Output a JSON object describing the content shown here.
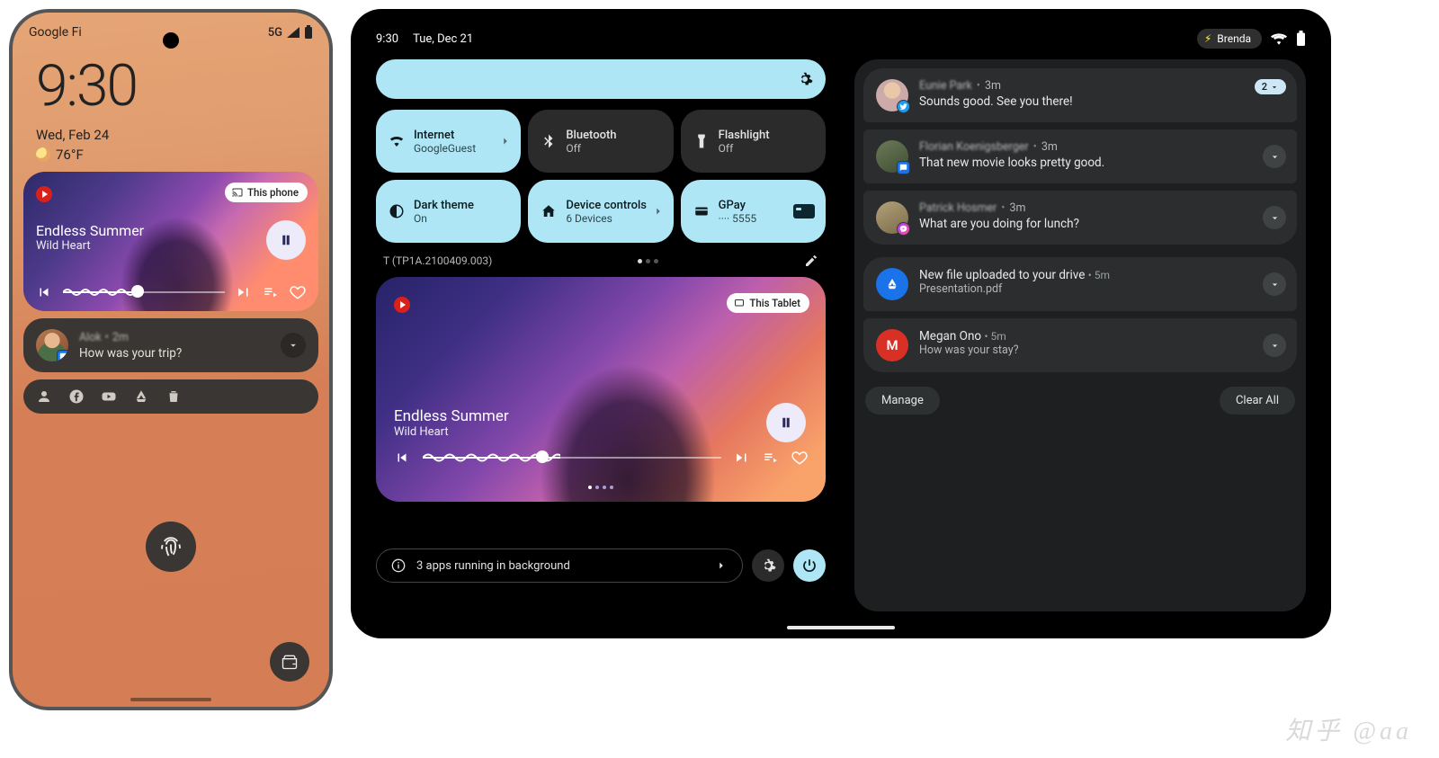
{
  "phone": {
    "status": {
      "carrier": "Google Fi",
      "net": "5G"
    },
    "clock": "9:30",
    "date": "Wed, Feb 24",
    "temp": "76°F",
    "media": {
      "chip": "This phone",
      "title": "Endless Summer",
      "artist": "Wild Heart"
    },
    "notif": {
      "name": "Alok",
      "time": "2m",
      "body": "How was your trip?"
    }
  },
  "tablet": {
    "status": {
      "time": "9:30",
      "date": "Tue, Dec 21",
      "user": "Brenda"
    },
    "tiles": {
      "internet": {
        "title": "Internet",
        "sub": "GoogleGuest"
      },
      "bluetooth": {
        "title": "Bluetooth",
        "sub": "Off"
      },
      "flash": {
        "title": "Flashlight",
        "sub": "Off"
      },
      "dark": {
        "title": "Dark theme",
        "sub": "On"
      },
      "devctrl": {
        "title": "Device controls",
        "sub": "6 Devices"
      },
      "gpay": {
        "title": "GPay",
        "sub": "···· 5555"
      }
    },
    "build": "T (TP1A.2100409.003)",
    "media": {
      "chip": "This Tablet",
      "title": "Endless Summer",
      "artist": "Wild Heart"
    },
    "bg_apps": "3 apps running in background",
    "notifs": [
      {
        "name": "Eunie Park",
        "time": "3m",
        "body": "Sounds good. See you there!",
        "count": "2"
      },
      {
        "name": "Florian Koenigsberger",
        "time": "3m",
        "body": "That new movie looks pretty good."
      },
      {
        "name": "Patrick Hosmer",
        "time": "3m",
        "body": "What are you doing for lunch?"
      }
    ],
    "drive": {
      "title": "New file uploaded to your drive",
      "time": "5m",
      "file": "Presentation.pdf"
    },
    "mail": {
      "name": "Megan Ono",
      "time": "5m",
      "body": "How was your stay?"
    },
    "actions": {
      "manage": "Manage",
      "clear": "Clear All"
    }
  },
  "watermark": "知乎 @aa"
}
